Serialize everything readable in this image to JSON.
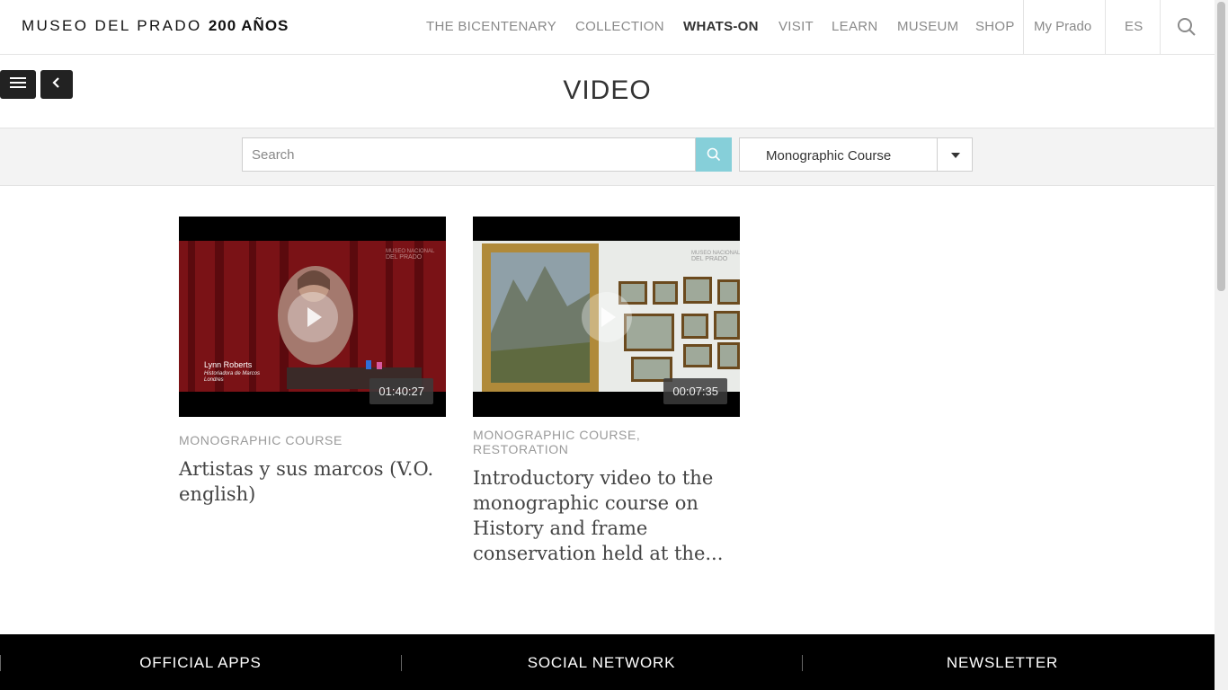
{
  "header": {
    "logo_main": "MUSEO DEL PRADO",
    "logo_accent": "200 AÑOS",
    "nav": [
      {
        "label": "THE BICENTENARY"
      },
      {
        "label": "COLLECTION"
      },
      {
        "label": "WHATS-ON",
        "active": true
      },
      {
        "label": "VISIT"
      },
      {
        "label": "LEARN"
      },
      {
        "label": "MUSEUM"
      },
      {
        "label": "SHOP"
      },
      {
        "label": "My Prado"
      },
      {
        "label": "ES"
      }
    ],
    "search_icon": "search-icon"
  },
  "page": {
    "title": "VIDEO",
    "menu_icon": "hamburger-menu-icon",
    "back_icon": "chevron-left-icon"
  },
  "filter": {
    "search_placeholder": "Search",
    "search_value": "",
    "category_selected": "Monographic Course",
    "accent_color": "#86cfd9"
  },
  "videos": [
    {
      "category": "MONOGRAPHIC COURSE",
      "title": "Artistas y sus marcos (V.O. english)",
      "duration": "01:40:27"
    },
    {
      "category": "MONOGRAPHIC COURSE, RESTORATION",
      "title": "Introductory video to the monographic course on History and frame conservation held at the...",
      "duration": "00:07:35"
    }
  ],
  "footer": {
    "items": [
      "OFFICIAL APPS",
      "SOCIAL NETWORK",
      "NEWSLETTER"
    ]
  }
}
